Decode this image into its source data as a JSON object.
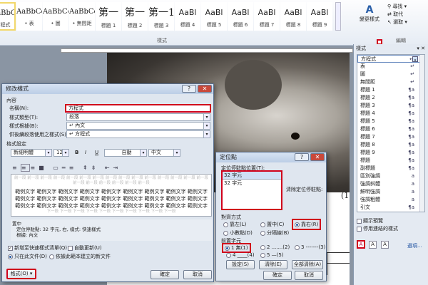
{
  "ribbon": {
    "gallery": [
      {
        "sample": "AaBbCcI",
        "label": "方程式"
      },
      {
        "sample": "AaBbCcI",
        "label": "• 表"
      },
      {
        "sample": "AaBbCcI",
        "label": "• 圖"
      },
      {
        "sample": "AaBbCcI",
        "label": "• 無間距"
      },
      {
        "sample": "第一",
        "label": "標題 1"
      },
      {
        "sample": "第一",
        "label": "標題 2"
      },
      {
        "sample": "第一1",
        "label": "標題 3"
      },
      {
        "sample": "AaBl",
        "label": "標題 4"
      },
      {
        "sample": "AaBl",
        "label": "標題 5"
      },
      {
        "sample": "AaBl",
        "label": "標題 6"
      },
      {
        "sample": "AaBl",
        "label": "標題 7"
      },
      {
        "sample": "AaBl",
        "label": "標題 8"
      },
      {
        "sample": "AaBl",
        "label": "標題 9"
      }
    ],
    "styles_group": "樣式",
    "change_styles": "變更樣式",
    "edit_group": "編輯",
    "find": "尋找",
    "replace": "取代",
    "select": "選取"
  },
  "pane": {
    "title": "樣式",
    "items": [
      {
        "label": "方程式",
        "mark": "↵"
      },
      {
        "label": "表",
        "mark": "↵"
      },
      {
        "label": "圖",
        "mark": "↵"
      },
      {
        "label": "無間距",
        "mark": "↵"
      },
      {
        "label": "標題 1",
        "mark": "¶a"
      },
      {
        "label": "標題 2",
        "mark": "¶a"
      },
      {
        "label": "標題 3",
        "mark": "¶a"
      },
      {
        "label": "標題 4",
        "mark": "¶a"
      },
      {
        "label": "標題 5",
        "mark": "¶a"
      },
      {
        "label": "標題 6",
        "mark": "¶a"
      },
      {
        "label": "標題 7",
        "mark": "¶a"
      },
      {
        "label": "標題 8",
        "mark": "¶a"
      },
      {
        "label": "標題 9",
        "mark": "¶a"
      },
      {
        "label": "標題",
        "mark": "¶a"
      },
      {
        "label": "副標題",
        "mark": "¶a"
      },
      {
        "label": "區別強調",
        "mark": "a"
      },
      {
        "label": "強調斜體",
        "mark": "a"
      },
      {
        "label": "鮮明強調",
        "mark": "a"
      },
      {
        "label": "強調粗體",
        "mark": "a"
      },
      {
        "label": "引文",
        "mark": "¶a"
      }
    ],
    "show_preview": "顯示預覽",
    "disable_linked": "停用連結的樣式",
    "options": "選項..."
  },
  "doc": {
    "eq_number": "(1"
  },
  "modify": {
    "title": "修改樣式",
    "section_props": "內容",
    "name_label": "名稱(N):",
    "name_value": "方程式",
    "type_label": "樣式類型(T):",
    "type_value": "段落",
    "based_label": "樣式根據(B):",
    "based_value": "↵ 內文",
    "next_label": "供後續段落使用之樣式(S):",
    "next_value": "↵ 方程式",
    "section_format": "格式設定",
    "font": "新細明體",
    "size": "12",
    "bold": "B",
    "italic": "I",
    "underline": "U",
    "color": "自動",
    "script": "中文",
    "prev_para": "前一段 前一段 前一段 前一段 前一段 前一段 前一段 前一段 前一段 前一段 前一段 前一段 前一段 前一段 前一段 前一段 前一段 前一段 前一段 前一段 前一段",
    "sample": "範例文字 範例文字 範例文字 範例文字 範例文字 範例文字 範例文字 範例文字 範例文字 範例文字 範例文字 範例文字 範例文字 範例文字 範例文字 範例文字 範例文字 範例文字 範例文字 範例文字 範例文字 範例文字 範例文字 範例文字 範例文字 範例文字 範例文字",
    "next_para": "下一段 下一段 下一段 下一段 下一段 下一段 下一段 下一段 下一段 下一段",
    "desc1": "置中",
    "desc2": "定位停駐點: 32 字元, 右, 樣式: 快速樣式",
    "desc3": "根據: 內文",
    "add_quick": "新增至快速樣式清單(Q)",
    "auto_update": "自動更新(U)",
    "only_doc": "只在此文件(D)",
    "new_docs": "依據此範本建立的新文件",
    "format_btn": "格式(O) ▾",
    "ok": "確定",
    "cancel": "取消"
  },
  "tabs": {
    "title": "定位點",
    "pos_label": "定位停駐點位置(T):",
    "pos_value": "32 字元",
    "list": [
      "32 字元"
    ],
    "clear_label": "清除定位停駐點:",
    "align_label": "對齊方式",
    "left": "靠左(L)",
    "center": "置中(C)",
    "right": "靠右(R)",
    "decimal": "小數點(D)",
    "bar": "分隔線(B)",
    "leader_label": "前置字元",
    "l1": "1 無(1)",
    "l2": "2 .......(2)",
    "l3": "3 -------(3)",
    "l4": "4 ____(4)",
    "l5": "5 —(5)",
    "set": "設定(S)",
    "clear": "清除(E)",
    "clear_all": "全部清除(A)",
    "ok": "確定",
    "cancel": "取消"
  }
}
